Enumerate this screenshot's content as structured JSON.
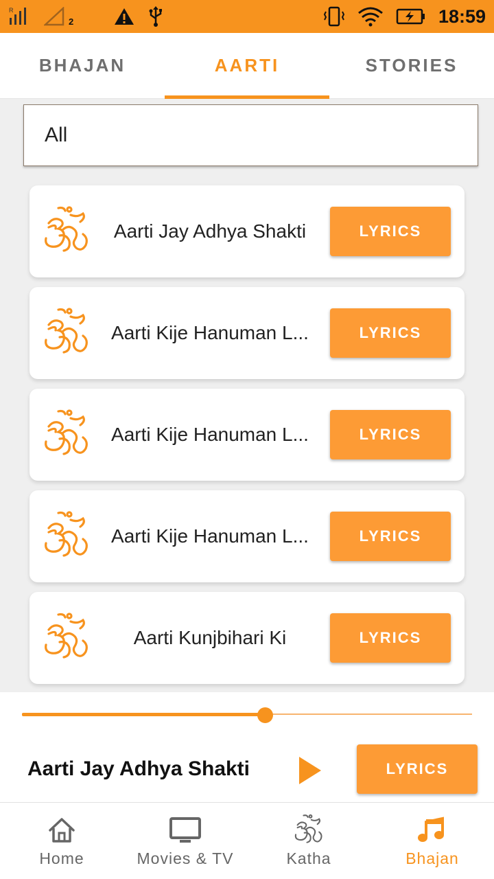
{
  "status_bar": {
    "time": "18:59",
    "sim_slot": "2",
    "icons": [
      "signal-icon",
      "no-signal-icon",
      "warning-icon",
      "usb-icon",
      "vibrate-icon",
      "wifi-icon",
      "battery-charging-icon"
    ],
    "background": "#f7931e"
  },
  "tabs": [
    {
      "label": "BHAJAN",
      "active": false
    },
    {
      "label": "AARTI",
      "active": true
    },
    {
      "label": "STORIES",
      "active": false
    }
  ],
  "filter": {
    "value": "All"
  },
  "list": {
    "items": [
      {
        "title": "Aarti Jay Adhya Shakti",
        "button": "LYRICS"
      },
      {
        "title": "Aarti Kije Hanuman L...",
        "button": "LYRICS"
      },
      {
        "title": "Aarti Kije Hanuman L...",
        "button": "LYRICS"
      },
      {
        "title": "Aarti Kije Hanuman L...",
        "button": "LYRICS"
      },
      {
        "title": "Aarti Kunjbihari Ki",
        "button": "LYRICS"
      }
    ]
  },
  "player": {
    "now_playing": "Aarti Jay Adhya Shakti",
    "progress": 0.54,
    "button": "LYRICS"
  },
  "bottom_nav": [
    {
      "label": "Home",
      "icon": "home-icon",
      "active": false
    },
    {
      "label": "Movies & TV",
      "icon": "tv-icon",
      "active": false
    },
    {
      "label": "Katha",
      "icon": "om-icon",
      "active": false
    },
    {
      "label": "Bhajan",
      "icon": "music-note-icon",
      "active": true
    }
  ],
  "colors": {
    "accent": "#f7931e",
    "button": "#fd9b35",
    "inactive": "#666666"
  }
}
